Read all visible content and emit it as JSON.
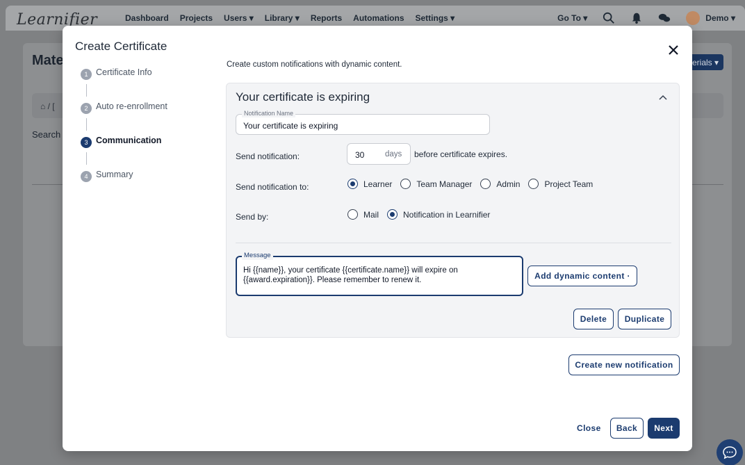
{
  "app": {
    "logo": "Learnifier",
    "nav": [
      "Dashboard",
      "Projects",
      "Users ▾",
      "Library ▾",
      "Reports",
      "Automations",
      "Settings ▾"
    ],
    "goto": "Go To ▾",
    "user": "Demo ▾",
    "page_title": "Mate",
    "search_label": "Search",
    "breadcrumb": "⌂ / [",
    "materials_button": "erials ▾"
  },
  "modal": {
    "title": "Create Certificate",
    "steps": [
      {
        "num": "1",
        "label": "Certificate Info"
      },
      {
        "num": "2",
        "label": "Auto re-enrollment"
      },
      {
        "num": "3",
        "label": "Communication"
      },
      {
        "num": "4",
        "label": "Summary"
      }
    ],
    "active_step": 3,
    "intro": "Create custom notifications with dynamic content.",
    "notification": {
      "title": "Your certificate is expiring",
      "name_legend": "Notification Name",
      "name_value": "Your certificate is expiring",
      "send_label": "Send notification:",
      "days_value": "30",
      "days_unit": "days",
      "days_suffix": "before certificate expires.",
      "to_label": "Send notification to:",
      "recipients": [
        {
          "label": "Learner",
          "selected": true
        },
        {
          "label": "Team Manager",
          "selected": false
        },
        {
          "label": "Admin",
          "selected": false
        },
        {
          "label": "Project Team",
          "selected": false
        }
      ],
      "by_label": "Send by:",
      "methods": [
        {
          "label": "Mail",
          "selected": false
        },
        {
          "label": "Notification in Learnifier",
          "selected": true
        }
      ],
      "message_legend": "Message",
      "message_text": "Hi {{name}}, your certificate {{certificate.name}} will expire on {{award.expiration}}. Please remember to renew it.",
      "dynamic_button": "Add dynamic content ·",
      "delete_button": "Delete",
      "duplicate_button": "Duplicate"
    },
    "create_button": "Create new notification",
    "close_button": "Close",
    "back_button": "Back",
    "next_button": "Next"
  },
  "colors": {
    "primary": "#1b3b6f",
    "panel_bg": "#f3f4f6"
  }
}
